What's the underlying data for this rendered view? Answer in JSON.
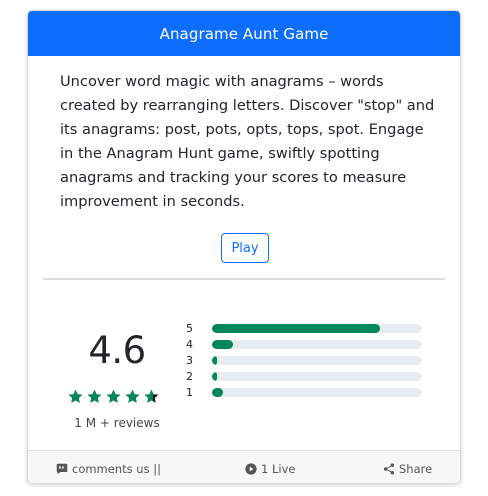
{
  "card": {
    "title": "Anagrame Aunt Game",
    "description": "Uncover word magic with anagrams – words created by rearranging letters. Discover \"stop\" and its anagrams: post, pots, opts, tops, spot. Engage in the Anagram Hunt game, swiftly spotting anagrams and tracking your scores to measure improvement in seconds.",
    "play_label": "Play"
  },
  "rating": {
    "average": "4.6",
    "stars_value": 4.6,
    "stars_max": 5,
    "reviews": "1 M + reviews",
    "star_color": "#00875a",
    "bars": [
      {
        "label": "5",
        "fraction": 0.8
      },
      {
        "label": "4",
        "fraction": 0.1
      },
      {
        "label": "3",
        "fraction": 0.025
      },
      {
        "label": "2",
        "fraction": 0.015
      },
      {
        "label": "1",
        "fraction": 0.05
      }
    ],
    "bar_color": "#00875a"
  },
  "footer": {
    "comments_label": "comments us ||",
    "live_label": "1 Live",
    "share_label": "Share"
  },
  "colors": {
    "header": "#0d6efd",
    "accent": "#00875a"
  }
}
